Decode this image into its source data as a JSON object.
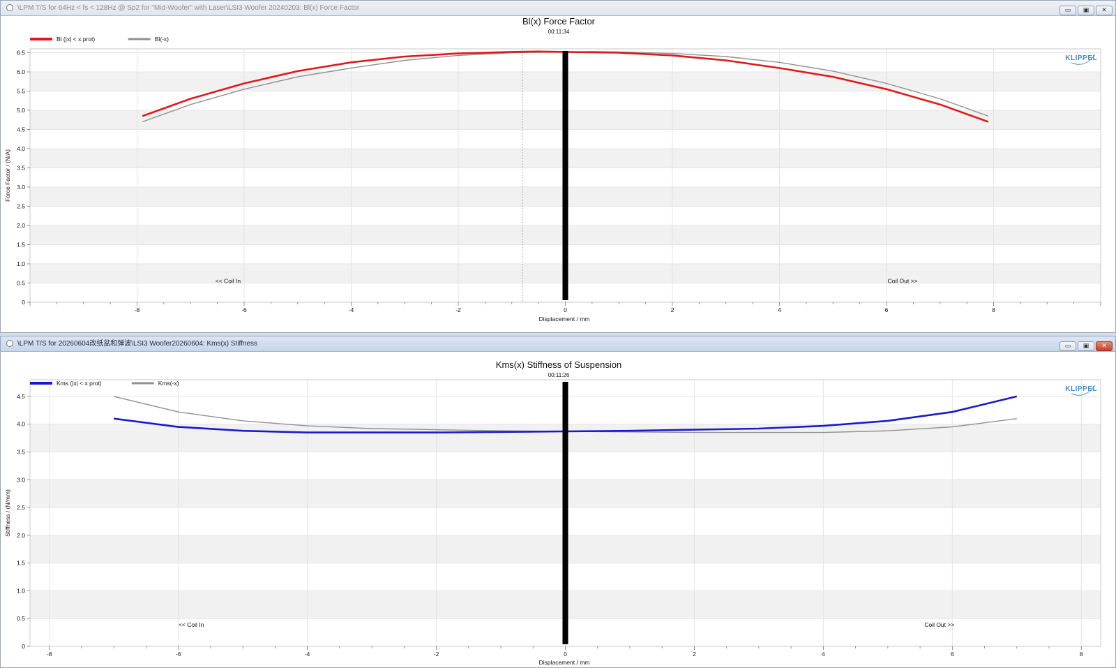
{
  "windows": [
    {
      "title": "\\LPM T/S for 64Hz < fs < 128Hz @ Sp2 for \"Mid-Woofer\" with Laser\\LSI3 Woofer 20240203: Bl(x) Force Factor",
      "buttons": {
        "minimize": "▭",
        "restore": "▣",
        "close": "✕"
      }
    },
    {
      "title": "\\LPM T/S for 20260604改纸盆和弹波\\LSI3 Woofer20260604: Kms(x) Stiffness",
      "buttons": {
        "minimize": "▭",
        "restore": "▣",
        "close": "✕"
      }
    }
  ],
  "chart_data": [
    {
      "type": "line",
      "title": "Bl(x) Force Factor",
      "subtitle": "00:11:34",
      "xlabel": "Displacement / mm",
      "ylabel": "Force Factor / (N/A)",
      "xlim": [
        -10,
        10
      ],
      "ylim": [
        0,
        6.6
      ],
      "xticks": [
        -8,
        -6,
        -4,
        -2,
        0,
        2,
        4,
        6,
        8
      ],
      "yticks": [
        0,
        0.5,
        1.0,
        1.5,
        2.0,
        2.5,
        3.0,
        3.5,
        4.0,
        4.5,
        5.0,
        5.5,
        6.0,
        6.5
      ],
      "grid": true,
      "legend_position": "top-left",
      "marker_x": 0,
      "dashed_x": -0.8,
      "annotations": [
        {
          "text": "<< Coil In",
          "x": -6.3,
          "y": 0.5
        },
        {
          "text": "Coil Out >>",
          "x": 6.3,
          "y": 0.5
        }
      ],
      "logo": "KLIPPEL",
      "series": [
        {
          "name": "Bl (|x| < x prot)",
          "color": "#e01818",
          "x": [
            -7.9,
            -7,
            -6,
            -5,
            -4,
            -3,
            -2,
            -1,
            -0.5,
            0,
            1,
            2,
            3,
            4,
            5,
            6,
            7,
            7.9
          ],
          "y": [
            4.85,
            5.3,
            5.7,
            6.02,
            6.25,
            6.4,
            6.48,
            6.52,
            6.53,
            6.52,
            6.5,
            6.43,
            6.3,
            6.1,
            5.87,
            5.55,
            5.15,
            4.7
          ]
        },
        {
          "name": "Bl(-x)",
          "color": "#909090",
          "x": [
            -7.9,
            -7,
            -6,
            -5,
            -4,
            -3,
            -2,
            -1,
            0,
            0.5,
            1,
            2,
            3,
            4,
            5,
            6,
            7,
            7.9
          ],
          "y": [
            4.7,
            5.15,
            5.55,
            5.87,
            6.1,
            6.3,
            6.43,
            6.5,
            6.52,
            6.53,
            6.52,
            6.48,
            6.4,
            6.25,
            6.02,
            5.7,
            5.3,
            4.85
          ]
        }
      ]
    },
    {
      "type": "line",
      "title": "Kms(x) Stiffness of Suspension",
      "subtitle": "00:11:26",
      "xlabel": "Displacement / mm",
      "ylabel": "Stiffness / (N/mm)",
      "xlim": [
        -8.3,
        8.3
      ],
      "ylim": [
        0,
        4.8
      ],
      "xticks": [
        -8,
        -6,
        -4,
        -2,
        0,
        2,
        4,
        6,
        8
      ],
      "yticks": [
        0,
        0.5,
        1.0,
        1.5,
        2.0,
        2.5,
        3.0,
        3.5,
        4.0,
        4.5
      ],
      "grid": true,
      "legend_position": "top-left",
      "marker_x": 0,
      "annotations": [
        {
          "text": "<< Coil In",
          "x": -5.8,
          "y": 0.35
        },
        {
          "text": "Coil Out >>",
          "x": 5.8,
          "y": 0.35
        }
      ],
      "logo": "KLIPPEL",
      "series": [
        {
          "name": "Kms (|x| < x prot)",
          "color": "#1a1acd",
          "x": [
            -7,
            -6,
            -5,
            -4,
            -3,
            -2,
            -1,
            0,
            1,
            2,
            3,
            4,
            5,
            6,
            7
          ],
          "y": [
            4.1,
            3.95,
            3.88,
            3.85,
            3.85,
            3.85,
            3.86,
            3.87,
            3.88,
            3.9,
            3.92,
            3.97,
            4.06,
            4.22,
            4.5
          ]
        },
        {
          "name": "Kms(-x)",
          "color": "#909090",
          "x": [
            -7,
            -6,
            -5,
            -4,
            -3,
            -2,
            -1,
            0,
            1,
            2,
            3,
            4,
            5,
            6,
            7
          ],
          "y": [
            4.5,
            4.22,
            4.06,
            3.97,
            3.92,
            3.9,
            3.88,
            3.87,
            3.86,
            3.85,
            3.85,
            3.85,
            3.88,
            3.95,
            4.1
          ]
        }
      ]
    }
  ]
}
